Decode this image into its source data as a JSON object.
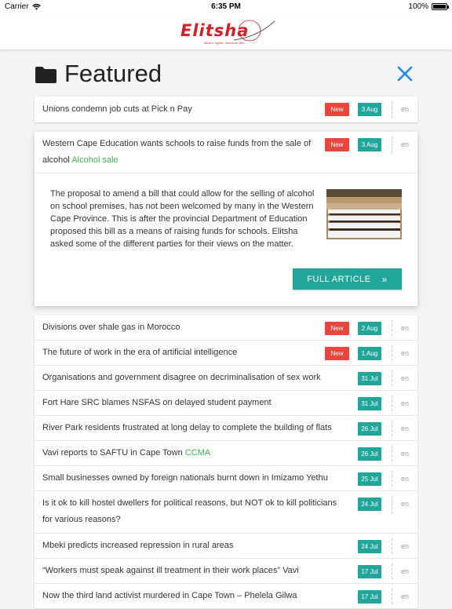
{
  "status_bar": {
    "carrier": "Carrier",
    "time": "6:35 PM",
    "battery": "100%"
  },
  "header": {
    "logo_text": "Elitsha",
    "logo_tagline": "labour rights, decisive dev"
  },
  "featured": {
    "title": "Featured"
  },
  "top_card": {
    "title": "Unions condemn job cuts at Pick n Pay",
    "new_label": "New",
    "date": "3 Aug",
    "lang": "en"
  },
  "expanded_card": {
    "title": "Western Cape Education wants schools to raise funds from the sale of alcohol",
    "tag": "Alcohol sale",
    "new_label": "New",
    "date": "3 Aug",
    "lang": "en",
    "summary": "The proposal to amend a bill that could allow for the selling of alcohol on school premises, has not been welcomed by many in the Western Cape Province. This is after the provincial Department of Education proposed this bill as a means of raising funds for schools. Elitsha asked some of the different parties for their views on the matter.",
    "button_label": "FULL ARTICLE"
  },
  "articles": [
    {
      "title": "Divisions over shale gas in Morocco",
      "tag": "",
      "new_label": "New",
      "date": "2 Aug",
      "lang": "en"
    },
    {
      "title": "The future of work in the era of artificial intelligence",
      "tag": "",
      "new_label": "New",
      "date": "1 Aug",
      "lang": "en"
    },
    {
      "title": "Organisations and government disagree on decriminalisation of sex work",
      "tag": "",
      "new_label": "",
      "date": "31 Jul",
      "lang": "en"
    },
    {
      "title": "Fort Hare SRC blames NSFAS on delayed student payment",
      "tag": "",
      "new_label": "",
      "date": "31 Jul",
      "lang": "en"
    },
    {
      "title": "River Park residents frustrated at long delay to complete the building of flats",
      "tag": "",
      "new_label": "",
      "date": "26 Jul",
      "lang": "en"
    },
    {
      "title": "Vavi reports to SAFTU in Cape Town",
      "tag": "CCMA",
      "new_label": "",
      "date": "26 Jul",
      "lang": "en"
    },
    {
      "title": "Small businesses owned by foreign nationals burnt down in Imizamo Yethu",
      "tag": "",
      "new_label": "",
      "date": "25 Jul",
      "lang": "en"
    },
    {
      "title": "Is it ok to kill hostel dwellers for political reasons, but NOT ok to kill politicians for various reasons?",
      "tag": "",
      "new_label": "",
      "date": "24 Jul",
      "lang": "en"
    },
    {
      "title": "Mbeki predicts increased repression in rural areas",
      "tag": "",
      "new_label": "",
      "date": "24 Jul",
      "lang": "en"
    },
    {
      "title": "“Workers must speak against ill treatment in their work places” Vavi",
      "tag": "",
      "new_label": "",
      "date": "17 Jul",
      "lang": "en"
    },
    {
      "title": "Now the third land activist murdered in Cape Town – Phelela Gilwa",
      "tag": "",
      "new_label": "",
      "date": "17 Jul",
      "lang": "en"
    }
  ]
}
